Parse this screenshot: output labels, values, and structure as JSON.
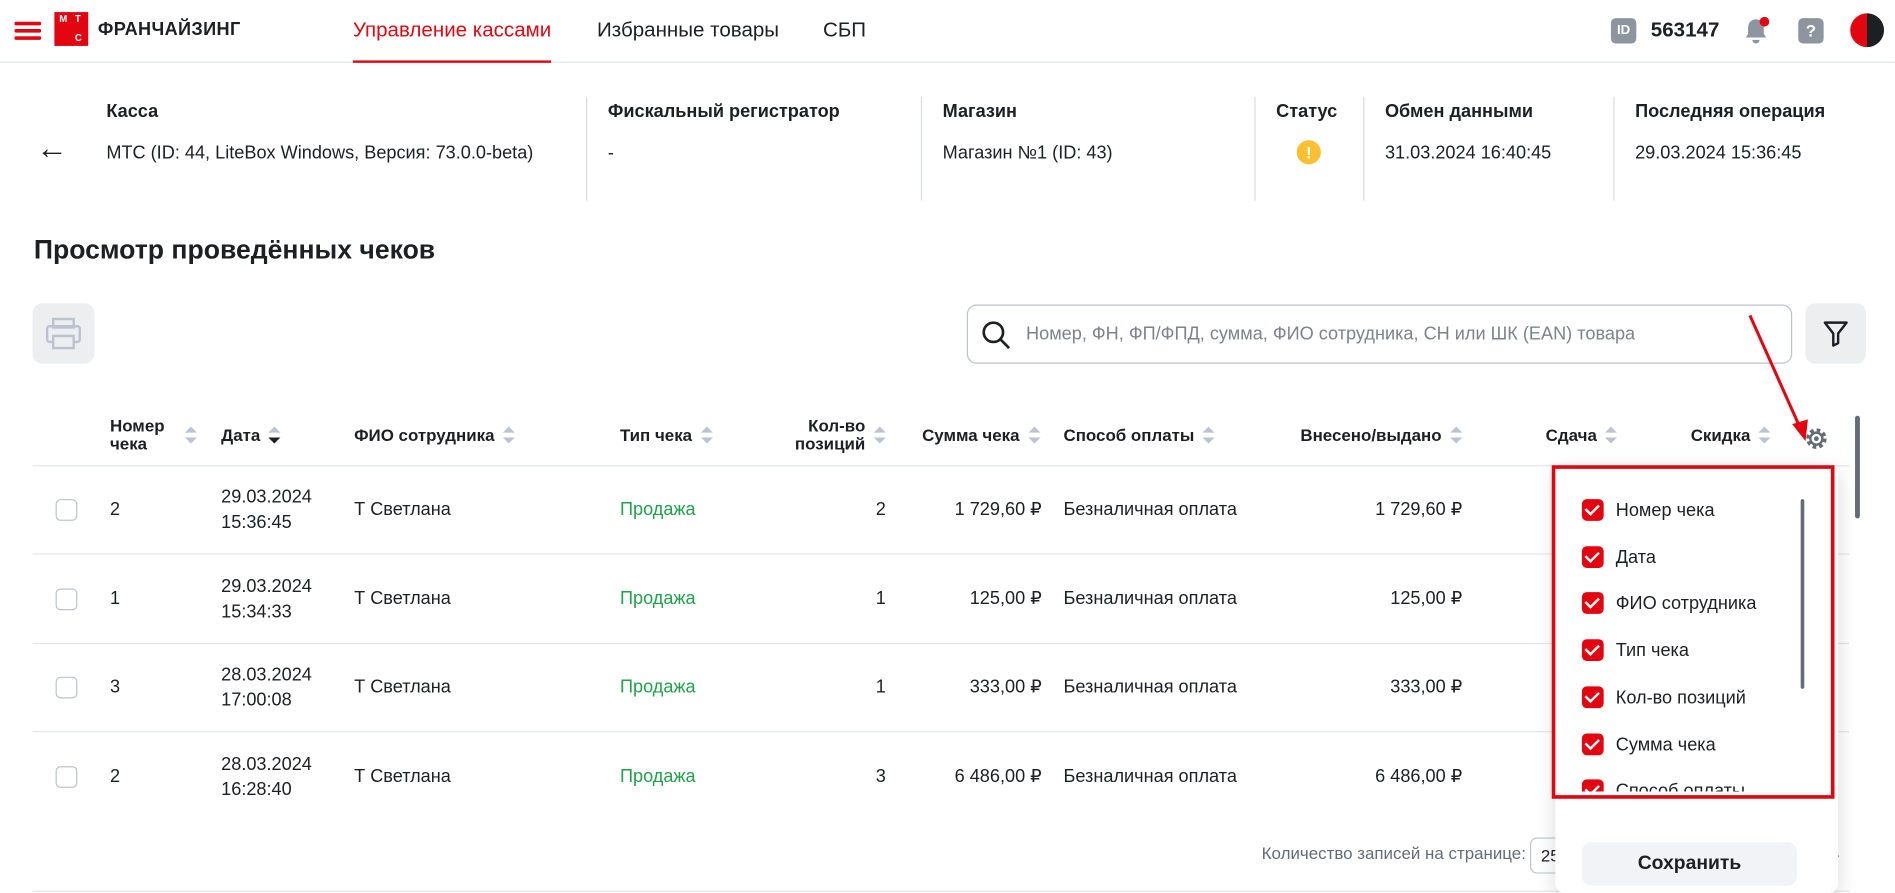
{
  "header": {
    "brand": "ФРАНЧАЙЗИНГ",
    "logo_letters": [
      "М",
      "Т",
      "С"
    ],
    "tabs": [
      {
        "label": "Управление кассами",
        "active": true
      },
      {
        "label": "Избранные товары",
        "active": false
      },
      {
        "label": "СБП",
        "active": false
      }
    ],
    "id_badge": "ID",
    "user_id": "563147",
    "help_label": "?"
  },
  "info": {
    "kassa": {
      "label": "Касса",
      "value": "МТС (ID: 44, LiteBox Windows, Версия: 73.0.0-beta)"
    },
    "fiscal": {
      "label": "Фискальный регистратор",
      "value": "-"
    },
    "shop": {
      "label": "Магазин",
      "value": "Магазин №1 (ID: 43)"
    },
    "status": {
      "label": "Статус",
      "icon": "warning-icon",
      "color": "#fac031"
    },
    "exchange": {
      "label": "Обмен данными",
      "value": "31.03.2024 16:40:45"
    },
    "last_op": {
      "label": "Последняя операция",
      "value": "29.03.2024 15:36:45"
    }
  },
  "page_title": "Просмотр проведённых чеков",
  "search": {
    "placeholder": "Номер, ФН, ФП/ФПД, сумма, ФИО сотрудника, СН или ШК (EAN) товара"
  },
  "table": {
    "columns": [
      "Номер чека",
      "Дата",
      "ФИО сотрудника",
      "Тип чека",
      "Кол-во позиций",
      "Сумма чека",
      "Способ оплаты",
      "Внесено/выдано",
      "Сдача",
      "Скидка"
    ],
    "rows": [
      {
        "num": "2",
        "date": "29.03.2024",
        "time": "15:36:45",
        "employee": "Т Светлана",
        "type": "Продажа",
        "qty": "2",
        "sum": "1 729,60 ₽",
        "payment": "Безналичная оплата",
        "paid": "1 729,60 ₽"
      },
      {
        "num": "1",
        "date": "29.03.2024",
        "time": "15:34:33",
        "employee": "Т Светлана",
        "type": "Продажа",
        "qty": "1",
        "sum": "125,00 ₽",
        "payment": "Безналичная оплата",
        "paid": "125,00 ₽"
      },
      {
        "num": "3",
        "date": "28.03.2024",
        "time": "17:00:08",
        "employee": "Т Светлана",
        "type": "Продажа",
        "qty": "1",
        "sum": "333,00 ₽",
        "payment": "Безналичная оплата",
        "paid": "333,00 ₽"
      },
      {
        "num": "2",
        "date": "28.03.2024",
        "time": "16:28:40",
        "employee": "Т Светлана",
        "type": "Продажа",
        "qty": "3",
        "sum": "6 486,00 ₽",
        "payment": "Безналичная оплата",
        "paid": "6 486,00 ₽"
      }
    ]
  },
  "pagination": {
    "label": "Количество записей на странице:",
    "value": "25"
  },
  "column_settings": {
    "items": [
      "Номер чека",
      "Дата",
      "ФИО сотрудника",
      "Тип чека",
      "Кол-во позиций",
      "Сумма чека",
      "Способ оплаты"
    ],
    "save_label": "Сохранить"
  },
  "colors": {
    "accent": "#e30611",
    "sale": "#20a14a",
    "warning": "#fac031"
  }
}
